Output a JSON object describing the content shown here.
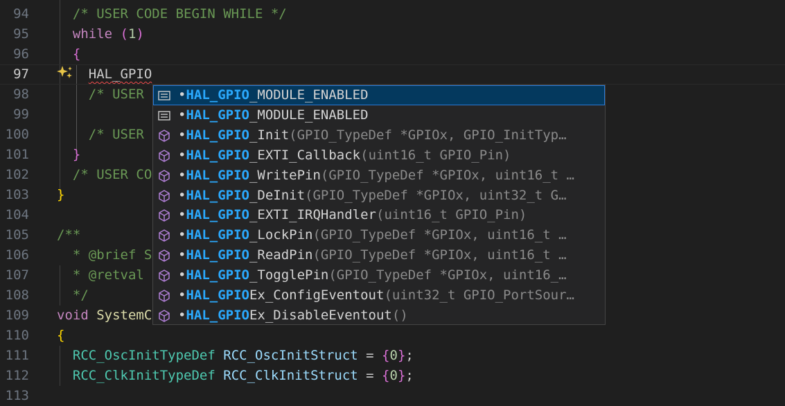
{
  "editor": {
    "lines": [
      {
        "n": "94",
        "parts": [
          {
            "t": "  "
          },
          {
            "t": "/* USER CODE BEGIN WHILE */",
            "c": "cm"
          }
        ]
      },
      {
        "n": "95",
        "parts": [
          {
            "t": "  "
          },
          {
            "t": "while",
            "c": "kw"
          },
          {
            "t": " ",
            "c": "plain"
          },
          {
            "t": "(",
            "c": "br2"
          },
          {
            "t": "1",
            "c": "num"
          },
          {
            "t": ")",
            "c": "br2"
          }
        ]
      },
      {
        "n": "96",
        "parts": [
          {
            "t": "  "
          },
          {
            "t": "{",
            "c": "br2"
          }
        ]
      },
      {
        "n": "97",
        "parts": [
          {
            "t": "    "
          },
          {
            "t": "HAL_GPIO",
            "c": "plain squiggle"
          }
        ]
      },
      {
        "n": "98",
        "parts": [
          {
            "t": "    "
          },
          {
            "t": "/* USER ",
            "c": "cm"
          }
        ]
      },
      {
        "n": "99",
        "parts": []
      },
      {
        "n": "100",
        "parts": [
          {
            "t": "    "
          },
          {
            "t": "/* USER ",
            "c": "cm"
          }
        ]
      },
      {
        "n": "101",
        "parts": [
          {
            "t": "  "
          },
          {
            "t": "}",
            "c": "br2"
          }
        ]
      },
      {
        "n": "102",
        "parts": [
          {
            "t": "  "
          },
          {
            "t": "/* USER CO",
            "c": "cm"
          }
        ]
      },
      {
        "n": "103",
        "parts": [
          {
            "t": "}",
            "c": "br1"
          }
        ]
      },
      {
        "n": "104",
        "parts": []
      },
      {
        "n": "105",
        "parts": [
          {
            "t": "/**",
            "c": "cm"
          }
        ]
      },
      {
        "n": "106",
        "parts": [
          {
            "t": "  * @brief S",
            "c": "cm"
          }
        ]
      },
      {
        "n": "107",
        "parts": [
          {
            "t": "  * @retval ",
            "c": "cm"
          }
        ]
      },
      {
        "n": "108",
        "parts": [
          {
            "t": "  */",
            "c": "cm"
          }
        ]
      },
      {
        "n": "109",
        "parts": [
          {
            "t": "void",
            "c": "kw"
          },
          {
            "t": " SystemC",
            "c": "fn"
          }
        ]
      },
      {
        "n": "110",
        "parts": [
          {
            "t": "{",
            "c": "br1"
          }
        ]
      },
      {
        "n": "111",
        "parts": [
          {
            "t": "  "
          },
          {
            "t": "RCC_OscInitTypeDef",
            "c": "ty"
          },
          {
            "t": " "
          },
          {
            "t": "RCC_OscInitStruct",
            "c": "var"
          },
          {
            "t": " = ",
            "c": "plain"
          },
          {
            "t": "{",
            "c": "br2"
          },
          {
            "t": "0",
            "c": "num"
          },
          {
            "t": "}",
            "c": "br2"
          },
          {
            "t": ";",
            "c": "plain"
          }
        ]
      },
      {
        "n": "112",
        "parts": [
          {
            "t": "  "
          },
          {
            "t": "RCC_ClkInitTypeDef",
            "c": "ty"
          },
          {
            "t": " "
          },
          {
            "t": "RCC_ClkInitStruct",
            "c": "var"
          },
          {
            "t": " = ",
            "c": "plain"
          },
          {
            "t": "{",
            "c": "br2"
          },
          {
            "t": "0",
            "c": "num"
          },
          {
            "t": "}",
            "c": "br2"
          },
          {
            "t": ";",
            "c": "plain"
          }
        ]
      },
      {
        "n": "113",
        "parts": []
      }
    ]
  },
  "suggestions": {
    "items": [
      {
        "icon": "macro-icon",
        "dot": "•",
        "match": "HAL_GPIO",
        "rest": "_MODULE_ENABLED",
        "sig": ""
      },
      {
        "icon": "macro-icon",
        "dot": "•",
        "match": "HAL_GPIO",
        "rest": "_MODULE_ENABLED",
        "sig": ""
      },
      {
        "icon": "method-icon",
        "dot": "•",
        "match": "HAL_GPIO",
        "rest": "_Init",
        "sig": "(GPIO_TypeDef *GPIOx, GPIO_InitTyp…"
      },
      {
        "icon": "method-icon",
        "dot": "•",
        "match": "HAL_GPIO",
        "rest": "_EXTI_Callback",
        "sig": "(uint16_t GPIO_Pin)"
      },
      {
        "icon": "method-icon",
        "dot": "•",
        "match": "HAL_GPIO",
        "rest": "_WritePin",
        "sig": "(GPIO_TypeDef *GPIOx, uint16_t …"
      },
      {
        "icon": "method-icon",
        "dot": "•",
        "match": "HAL_GPIO",
        "rest": "_DeInit",
        "sig": "(GPIO_TypeDef *GPIOx, uint32_t G…"
      },
      {
        "icon": "method-icon",
        "dot": "•",
        "match": "HAL_GPIO",
        "rest": "_EXTI_IRQHandler",
        "sig": "(uint16_t GPIO_Pin)"
      },
      {
        "icon": "method-icon",
        "dot": "•",
        "match": "HAL_GPIO",
        "rest": "_LockPin",
        "sig": "(GPIO_TypeDef *GPIOx, uint16_t …"
      },
      {
        "icon": "method-icon",
        "dot": "•",
        "match": "HAL_GPIO",
        "rest": "_ReadPin",
        "sig": "(GPIO_TypeDef *GPIOx, uint16_t …"
      },
      {
        "icon": "method-icon",
        "dot": "•",
        "match": "HAL_GPIO",
        "rest": "_TogglePin",
        "sig": "(GPIO_TypeDef *GPIOx, uint16_…"
      },
      {
        "icon": "method-icon",
        "dot": "•",
        "match": "HAL_GPIO",
        "rest": "Ex_ConfigEventout",
        "sig": "(uint32_t GPIO_PortSour…"
      },
      {
        "icon": "method-icon",
        "dot": "•",
        "match": "HAL_GPIO",
        "rest": "Ex_DisableEventout",
        "sig": "()"
      }
    ]
  },
  "gutter": {
    "lightbulb": "sparkle-icon"
  },
  "colors": {
    "background": "#1f1f1f",
    "match_highlight": "#2aaaff",
    "selection": "#04395e",
    "method_icon": "#b180d7",
    "comment": "#6a9955",
    "keyword": "#c586c0"
  }
}
